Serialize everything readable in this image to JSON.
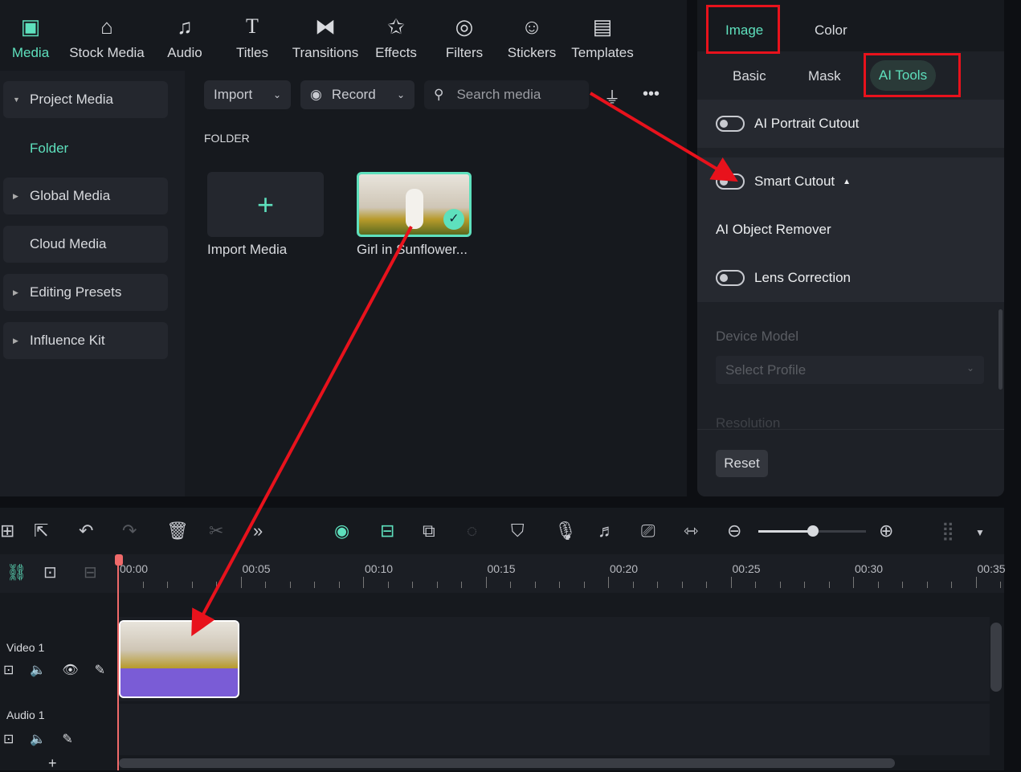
{
  "nav": [
    {
      "label": "Media",
      "icon": "media-icon"
    },
    {
      "label": "Stock Media",
      "icon": "stock-media-icon"
    },
    {
      "label": "Audio",
      "icon": "audio-icon"
    },
    {
      "label": "Titles",
      "icon": "titles-icon"
    },
    {
      "label": "Transitions",
      "icon": "transitions-icon"
    },
    {
      "label": "Effects",
      "icon": "effects-icon"
    },
    {
      "label": "Filters",
      "icon": "filters-icon"
    },
    {
      "label": "Stickers",
      "icon": "stickers-icon"
    },
    {
      "label": "Templates",
      "icon": "templates-icon"
    }
  ],
  "sidebar": {
    "project_media": "Project Media",
    "folder": "Folder",
    "global_media": "Global Media",
    "cloud_media": "Cloud Media",
    "editing_presets": "Editing Presets",
    "influence_kit": "Influence Kit"
  },
  "toolbar": {
    "import": "Import",
    "record": "Record",
    "search_placeholder": "Search media"
  },
  "folder_label": "FOLDER",
  "media": {
    "import_label": "Import Media",
    "clip_name": "Girl in Sunflower..."
  },
  "right": {
    "tabs": [
      "Image",
      "Color"
    ],
    "subtabs": [
      "Basic",
      "Mask",
      "AI Tools"
    ],
    "ai_portrait": "AI Portrait Cutout",
    "smart_cutout": "Smart Cutout",
    "object_remover": "AI Object Remover",
    "lens_correction": "Lens Correction",
    "device_model": "Device Model",
    "select_profile": "Select Profile",
    "resolution": "Resolution",
    "reset": "Reset"
  },
  "timeline": {
    "ticks": [
      "00:00",
      "00:05",
      "00:10",
      "00:15",
      "00:20",
      "00:25",
      "00:30",
      "00:35"
    ],
    "video_track": "Video 1",
    "audio_track": "Audio 1",
    "zoom_level": 0.5
  },
  "colors": {
    "accent": "#5ee0bd",
    "annotation": "#e8121c",
    "clip": "#7a5cd6"
  }
}
